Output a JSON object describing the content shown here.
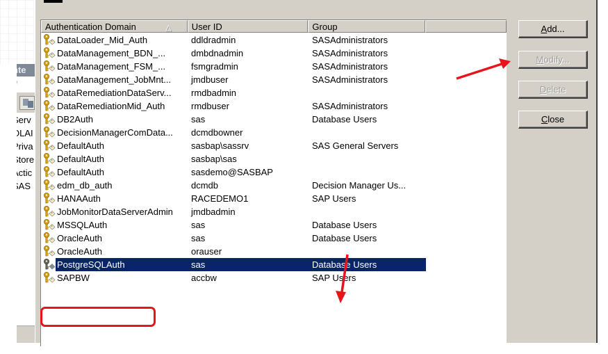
{
  "background_window": {
    "title_fragment": "nte",
    "subtitle_fragment": "w",
    "list_fragments": [
      "Serv",
      "OLAI",
      "Priva",
      "Store",
      "Actic",
      "SAS"
    ]
  },
  "dialog": {
    "columns": [
      {
        "label": "Authentication Domain",
        "sort": "ascending"
      },
      {
        "label": "User ID"
      },
      {
        "label": "Group"
      },
      {
        "label": ""
      }
    ],
    "rows": [
      {
        "domain": "DataLoader_Mid_Auth",
        "user_id": "ddldradmin",
        "group": "SASAdministrators"
      },
      {
        "domain": "DataManagement_BDN_...",
        "user_id": "dmbdnadmin",
        "group": "SASAdministrators"
      },
      {
        "domain": "DataManagement_FSM_...",
        "user_id": "fsmgradmin",
        "group": "SASAdministrators"
      },
      {
        "domain": "DataManagement_JobMnt...",
        "user_id": "jmdbuser",
        "group": "SASAdministrators"
      },
      {
        "domain": "DataRemediationDataServ...",
        "user_id": "rmdbadmin",
        "group": ""
      },
      {
        "domain": "DataRemediationMid_Auth",
        "user_id": "rmdbuser",
        "group": "SASAdministrators"
      },
      {
        "domain": "DB2Auth",
        "user_id": "sas",
        "group": "Database Users"
      },
      {
        "domain": "DecisionManagerComData...",
        "user_id": "dcmdbowner",
        "group": ""
      },
      {
        "domain": "DefaultAuth",
        "user_id": "sasbap\\sassrv",
        "group": "SAS General Servers"
      },
      {
        "domain": "DefaultAuth",
        "user_id": "sasbap\\sas",
        "group": ""
      },
      {
        "domain": "DefaultAuth",
        "user_id": "sasdemo@SASBAP",
        "group": ""
      },
      {
        "domain": "edm_db_auth",
        "user_id": "dcmdb",
        "group": "Decision Manager Us..."
      },
      {
        "domain": "HANAAuth",
        "user_id": "RACEDEMO1",
        "group": "SAP Users"
      },
      {
        "domain": "JobMonitorDataServerAdmin",
        "user_id": "jmdbadmin",
        "group": ""
      },
      {
        "domain": "MSSQLAuth",
        "user_id": "sas",
        "group": "Database Users"
      },
      {
        "domain": "OracleAuth",
        "user_id": "sas",
        "group": "Database Users"
      },
      {
        "domain": "OracleAuth",
        "user_id": "orauser",
        "group": ""
      },
      {
        "domain": "PostgreSQLAuth",
        "user_id": "sas",
        "group": "Database Users",
        "selected": true
      },
      {
        "domain": "SAPBW",
        "user_id": "accbw",
        "group": "SAP Users"
      }
    ],
    "buttons": {
      "add": {
        "label_mnemonic": "A",
        "label_rest": "dd...",
        "enabled": true
      },
      "modify": {
        "label_mnemonic": "M",
        "label_rest": "odify...",
        "enabled": false
      },
      "delete": {
        "label_mnemonic": "D",
        "label_rest": "elete",
        "enabled": false
      },
      "close": {
        "label_mnemonic": "C",
        "label_rest": "lose",
        "enabled": true
      }
    }
  },
  "annotations": {
    "color": "#e8141b",
    "highlight_target": "PostgreSQLAuth",
    "arrows": [
      "arrow-to-modify-button",
      "arrow-to-selected-group"
    ]
  },
  "colors": {
    "selection": "#0a246a",
    "dialog_face": "#d4d0c8"
  }
}
